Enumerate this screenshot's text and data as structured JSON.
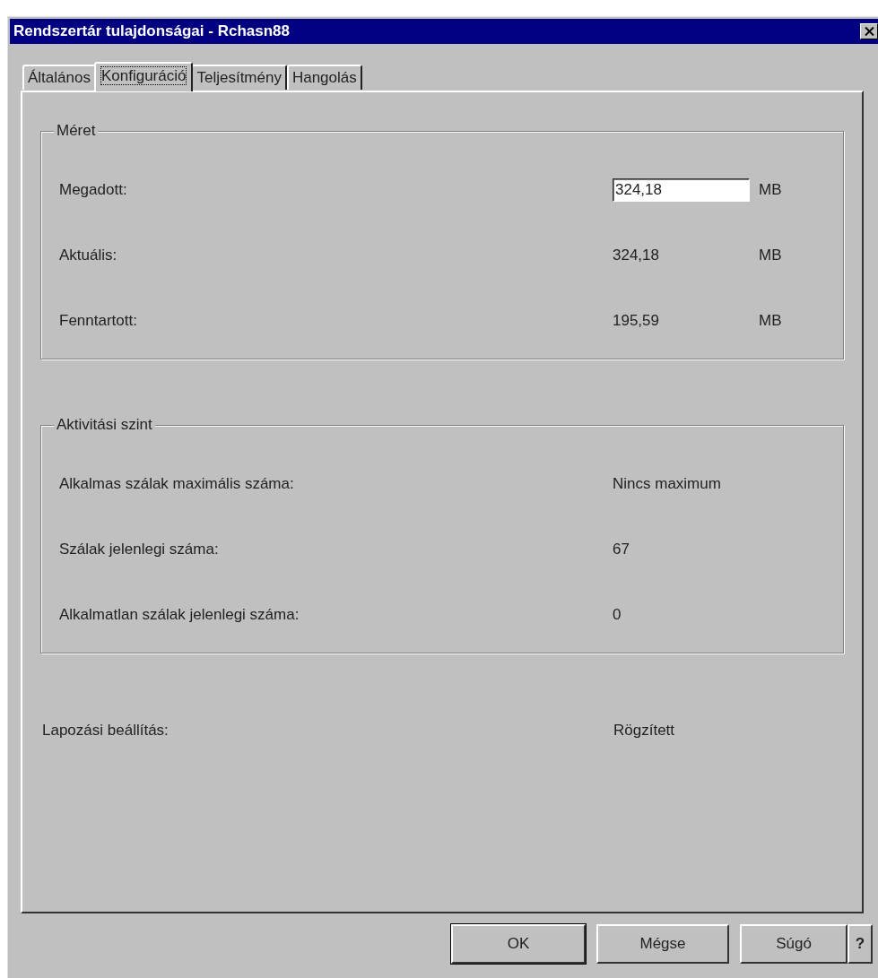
{
  "window": {
    "title": "Rendszertár tulajdonságai - Rchasn88"
  },
  "tabs": [
    {
      "label": "Általános",
      "selected": false
    },
    {
      "label": "Konfiguráció",
      "selected": true
    },
    {
      "label": "Teljesítmény",
      "selected": false
    },
    {
      "label": "Hangolás",
      "selected": false
    }
  ],
  "sections": [
    {
      "kind": "group",
      "title": "Méret",
      "rows": [
        {
          "kind": "input",
          "label": "Megadott:",
          "value": "324,18",
          "unit": "MB"
        },
        {
          "kind": "text",
          "label": "Aktuális:",
          "value": "324,18",
          "unit": "MB"
        },
        {
          "kind": "text",
          "label": "Fenntartott:",
          "value": "195,59",
          "unit": "MB"
        }
      ]
    },
    {
      "kind": "group",
      "title": "Aktivitási szint",
      "rows": [
        {
          "kind": "text",
          "label": "Alkalmas szálak maximális száma:",
          "value": "Nincs maximum"
        },
        {
          "kind": "text",
          "label": "Szálak jelenlegi száma:",
          "value": "67"
        },
        {
          "kind": "text",
          "label": "Alkalmatlan szálak jelenlegi száma:",
          "value": "0"
        }
      ]
    },
    {
      "kind": "plain",
      "rows": [
        {
          "kind": "text",
          "label": "Lapozási beállítás:",
          "value": "Rögzített"
        }
      ]
    }
  ],
  "buttons": [
    {
      "label": "OK",
      "default": true
    },
    {
      "label": "Mégse",
      "default": false
    },
    {
      "label": "Súgó",
      "default": false
    },
    {
      "label": "?",
      "default": false
    }
  ]
}
